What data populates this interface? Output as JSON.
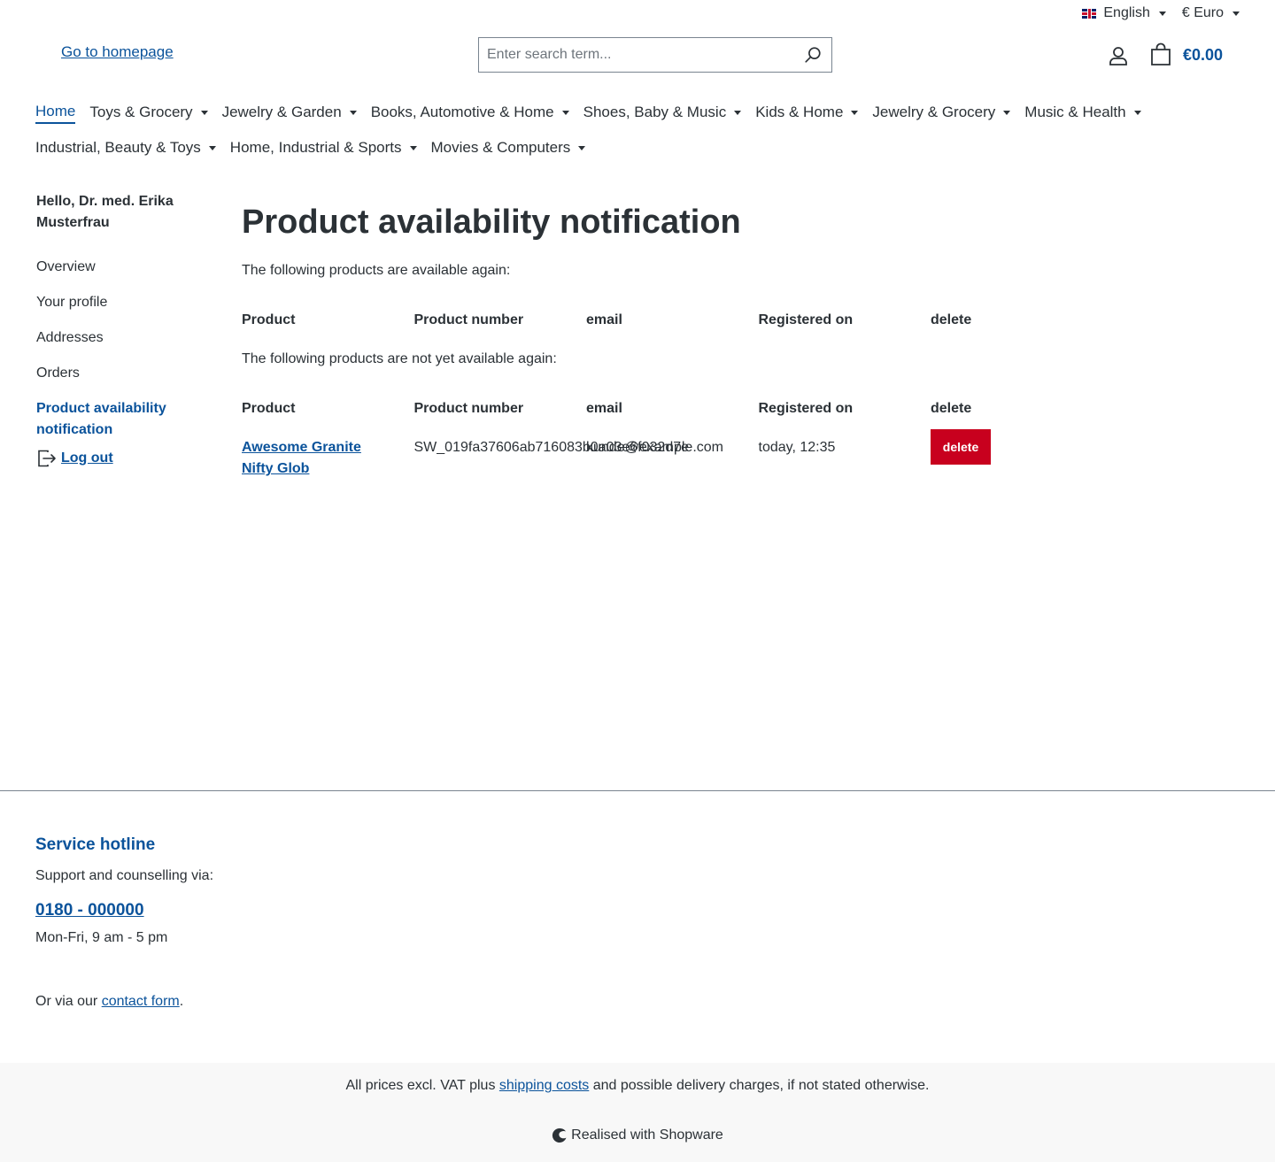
{
  "topbar": {
    "language": "English",
    "currency": "€ Euro"
  },
  "header": {
    "logo_alt": "Go to homepage",
    "search_placeholder": "Enter search term...",
    "cart_total": "€0.00"
  },
  "nav": {
    "items": [
      {
        "label": "Home",
        "active": true,
        "dropdown": false
      },
      {
        "label": "Toys & Grocery",
        "dropdown": true
      },
      {
        "label": "Jewelry & Garden",
        "dropdown": true
      },
      {
        "label": "Books, Automotive & Home",
        "dropdown": true
      },
      {
        "label": "Shoes, Baby & Music",
        "dropdown": true
      },
      {
        "label": "Kids & Home",
        "dropdown": true
      },
      {
        "label": "Jewelry & Grocery",
        "dropdown": true
      },
      {
        "label": "Music & Health",
        "dropdown": true
      },
      {
        "label": "Industrial, Beauty & Toys",
        "dropdown": true
      },
      {
        "label": "Home, Industrial & Sports",
        "dropdown": true
      },
      {
        "label": "Movies & Computers",
        "dropdown": true
      }
    ]
  },
  "sidebar": {
    "greeting": "Hello, Dr. med. Erika Musterfrau",
    "items": [
      {
        "label": "Overview"
      },
      {
        "label": "Your profile"
      },
      {
        "label": "Addresses"
      },
      {
        "label": "Orders"
      },
      {
        "label": "Product availability notification",
        "active": true
      }
    ],
    "logout": "Log out"
  },
  "main": {
    "title": "Product availability notification",
    "available_intro": "The following products are available again:",
    "not_available_intro": "The following products are not yet available again:",
    "columns": [
      "Product",
      "Product number",
      "email",
      "Registered on",
      "delete"
    ],
    "rows": [
      {
        "product": "Awesome Granite Nifty Glob",
        "number": "SW_019fa37606ab716083b0a03e6f032d7e",
        "email": "kunde@example.com",
        "registered": "today, 12:35",
        "delete_label": "delete"
      }
    ]
  },
  "footer": {
    "hotline_title": "Service hotline",
    "support": "Support and counselling via:",
    "phone": "0180 - 000000",
    "hours": "Mon-Fri, 9 am - 5 pm",
    "contact_prefix": "Or via our ",
    "contact_link": "contact form",
    "contact_suffix": ".",
    "vat_prefix": "All prices excl. VAT plus ",
    "vat_link": "shipping costs",
    "vat_suffix": " and possible delivery charges, if not stated otherwise.",
    "realised": "Realised with Shopware"
  },
  "colors": {
    "primary": "#0b539b",
    "danger": "#c8001e",
    "text": "#2b3136"
  }
}
